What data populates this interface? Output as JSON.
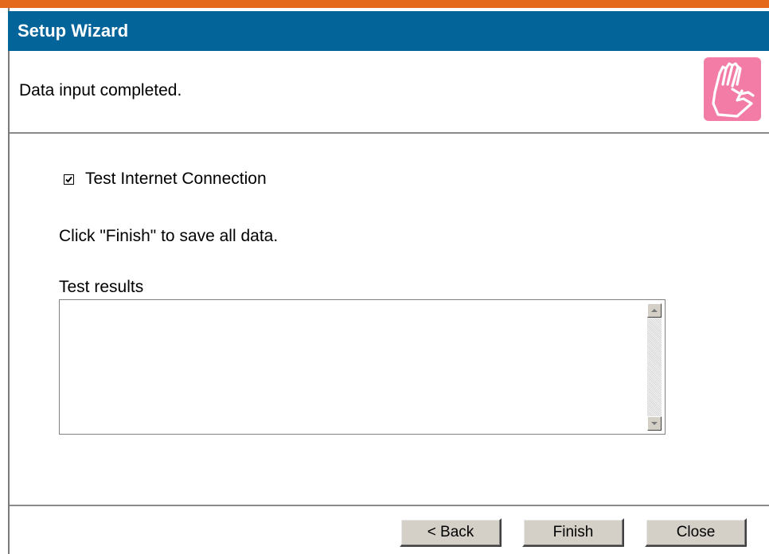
{
  "window": {
    "title": "Setup Wizard"
  },
  "header": {
    "message": "Data input completed.",
    "icon": "hand-icon"
  },
  "options": {
    "test_connection_label": "Test Internet Connection",
    "test_connection_checked": true
  },
  "instructions": {
    "finish_text": "Click \"Finish\" to save all data."
  },
  "results": {
    "label": "Test results",
    "value": ""
  },
  "footer": {
    "back_label": "< Back",
    "finish_label": "Finish",
    "close_label": "Close"
  },
  "colors": {
    "accent_bar": "#e5691c",
    "title_bar": "#03649a",
    "icon_bg": "#f27ca6",
    "button_face": "#d4d0c8"
  }
}
